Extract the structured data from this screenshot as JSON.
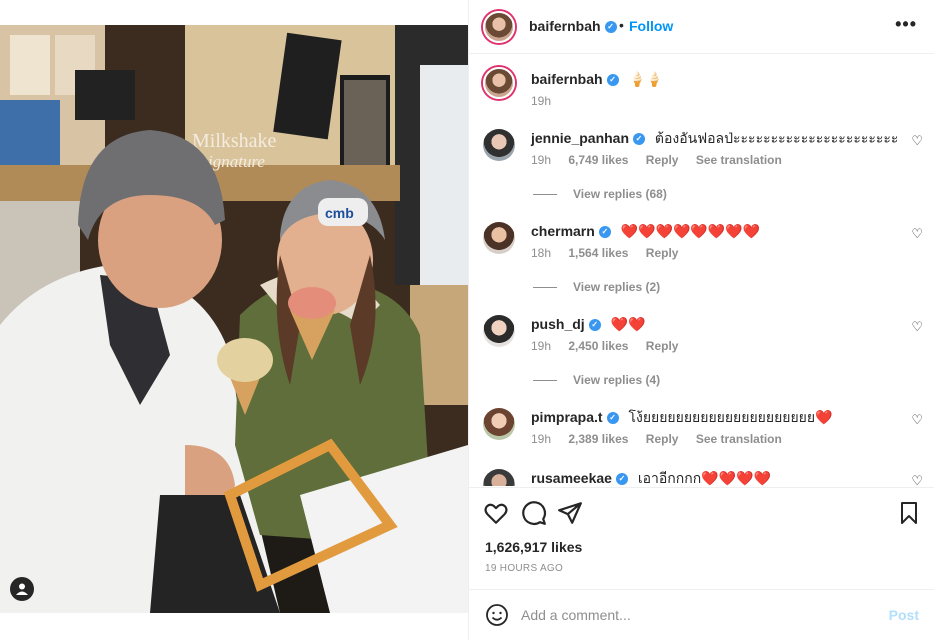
{
  "post": {
    "author": "baifernbah",
    "follow_label": "Follow",
    "caption": "🍦🍦",
    "caption_time": "19h",
    "likes": "1,626,917 likes",
    "time_ago": "19 HOURS AGO",
    "photo_sign": "Milkshake",
    "photo_sign2": "ignature",
    "photo_cap": "cmb"
  },
  "comments": [
    {
      "user": "jennie_panhan",
      "text": "ต้องอันฟอลป่ะะะะะะะะะะะะะะะะะะะะะะ",
      "time": "19h",
      "likes": "6,749 likes",
      "reply": "Reply",
      "translate": "See translation",
      "replies": "View replies (68)"
    },
    {
      "user": "chermarn",
      "text": "❤️❤️❤️❤️❤️❤️❤️❤️",
      "time": "18h",
      "likes": "1,564 likes",
      "reply": "Reply",
      "translate": "",
      "replies": "View replies (2)"
    },
    {
      "user": "push_dj",
      "text": "❤️❤️",
      "time": "19h",
      "likes": "2,450 likes",
      "reply": "Reply",
      "translate": "",
      "replies": "View replies (4)"
    },
    {
      "user": "pimprapa.t",
      "text": "โง้ยยยยยยยยยยยยยยยยยยยยย❤️",
      "time": "19h",
      "likes": "2,389 likes",
      "reply": "Reply",
      "translate": "See translation",
      "replies": ""
    },
    {
      "user": "rusameekae",
      "text": "เอาอีกกกก❤️❤️❤️❤️",
      "time": "",
      "likes": "",
      "reply": "",
      "translate": "",
      "replies": ""
    }
  ],
  "composer": {
    "placeholder": "Add a comment...",
    "post_label": "Post"
  },
  "icons": {
    "like": "heart-icon",
    "comment": "comment-icon",
    "share": "send-icon",
    "save": "bookmark-icon",
    "more": "more-icon",
    "emoji": "emoji-icon",
    "user_tag": "user-tag-icon"
  },
  "colors": {
    "link_blue": "#0095f6",
    "verified_blue": "#3897f0",
    "post_disabled": "#b2dffc",
    "muted_text": "#8e8e8e"
  }
}
